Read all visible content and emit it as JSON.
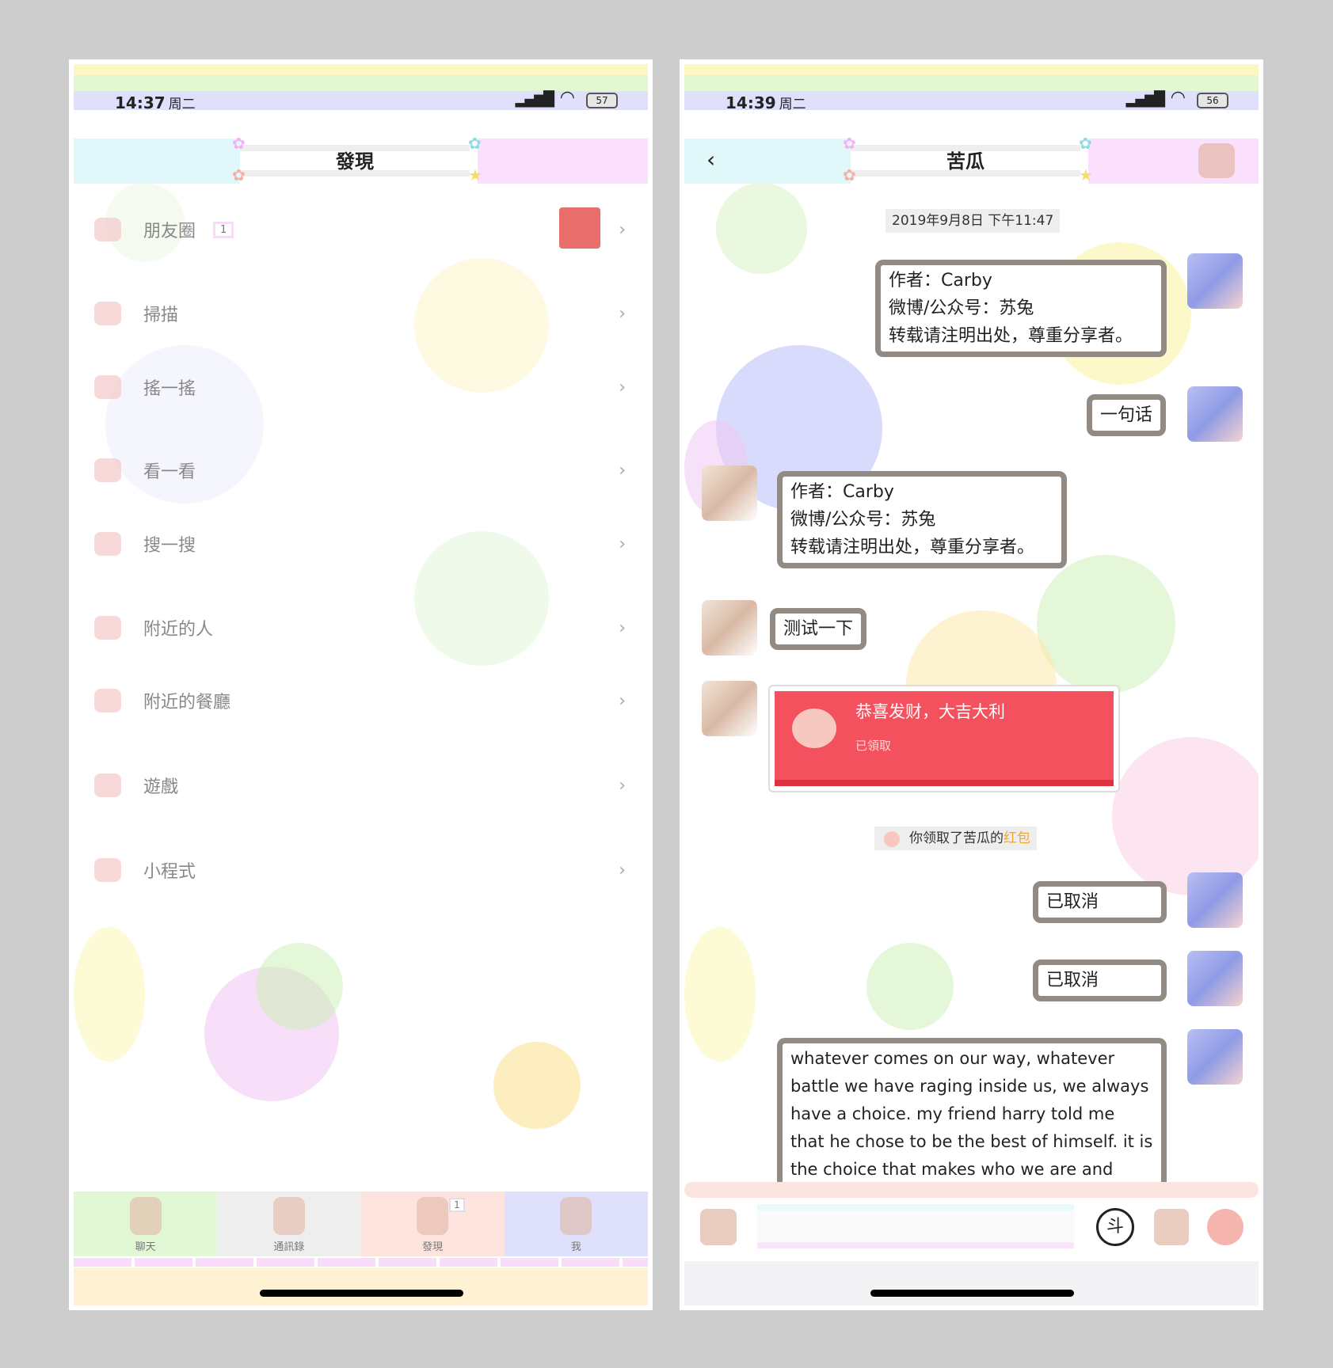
{
  "left": {
    "status": {
      "time": "14:37",
      "weekday": "周二",
      "battery": "57"
    },
    "title": "發現",
    "moments_badge": "1",
    "menu": [
      {
        "label": "朋友圈"
      },
      {
        "label": "掃描"
      },
      {
        "label": "搖一搖"
      },
      {
        "label": "看一看"
      },
      {
        "label": "搜一搜"
      },
      {
        "label": "附近的人"
      },
      {
        "label": "附近的餐廳"
      },
      {
        "label": "遊戲"
      },
      {
        "label": "小程式"
      }
    ],
    "tabs": [
      {
        "label": "聊天"
      },
      {
        "label": "通訊錄"
      },
      {
        "label": "發現",
        "badge": "1"
      },
      {
        "label": "我"
      }
    ]
  },
  "right": {
    "status": {
      "time": "14:39",
      "weekday": "周二",
      "battery": "56"
    },
    "title": "苦瓜",
    "date": "2019年9月8日 下午11:47",
    "messages": [
      {
        "side": "right",
        "lines": [
          "作者：Carby",
          "微博/公众号：苏兔",
          "转载请注明出处，尊重分享者。"
        ]
      },
      {
        "side": "right",
        "text": "一句话"
      },
      {
        "side": "left",
        "lines": [
          "作者：Carby",
          "微博/公众号：苏兔",
          "转载请注明出处，尊重分享者。"
        ]
      },
      {
        "side": "left",
        "text": "测试一下"
      },
      {
        "side": "left",
        "redpacket": {
          "title": "恭喜发财，大吉大利",
          "status": "已領取"
        }
      },
      {
        "system": {
          "prefix": "你领取了苦瓜的",
          "link": "红包"
        }
      },
      {
        "side": "right",
        "text": "已取消"
      },
      {
        "side": "right",
        "text": "已取消"
      },
      {
        "side": "right",
        "text": "whatever comes on our way, whatever battle we have raging inside us, we always have a choice. my friend harry told me that he chose to be the best of himself. it is the choice that makes who we are and"
      }
    ],
    "voice_icon_label": "斗"
  },
  "colors": {
    "red_packet": "#f4515e",
    "link": "#f5a623",
    "bubble_border": "#928b83"
  }
}
